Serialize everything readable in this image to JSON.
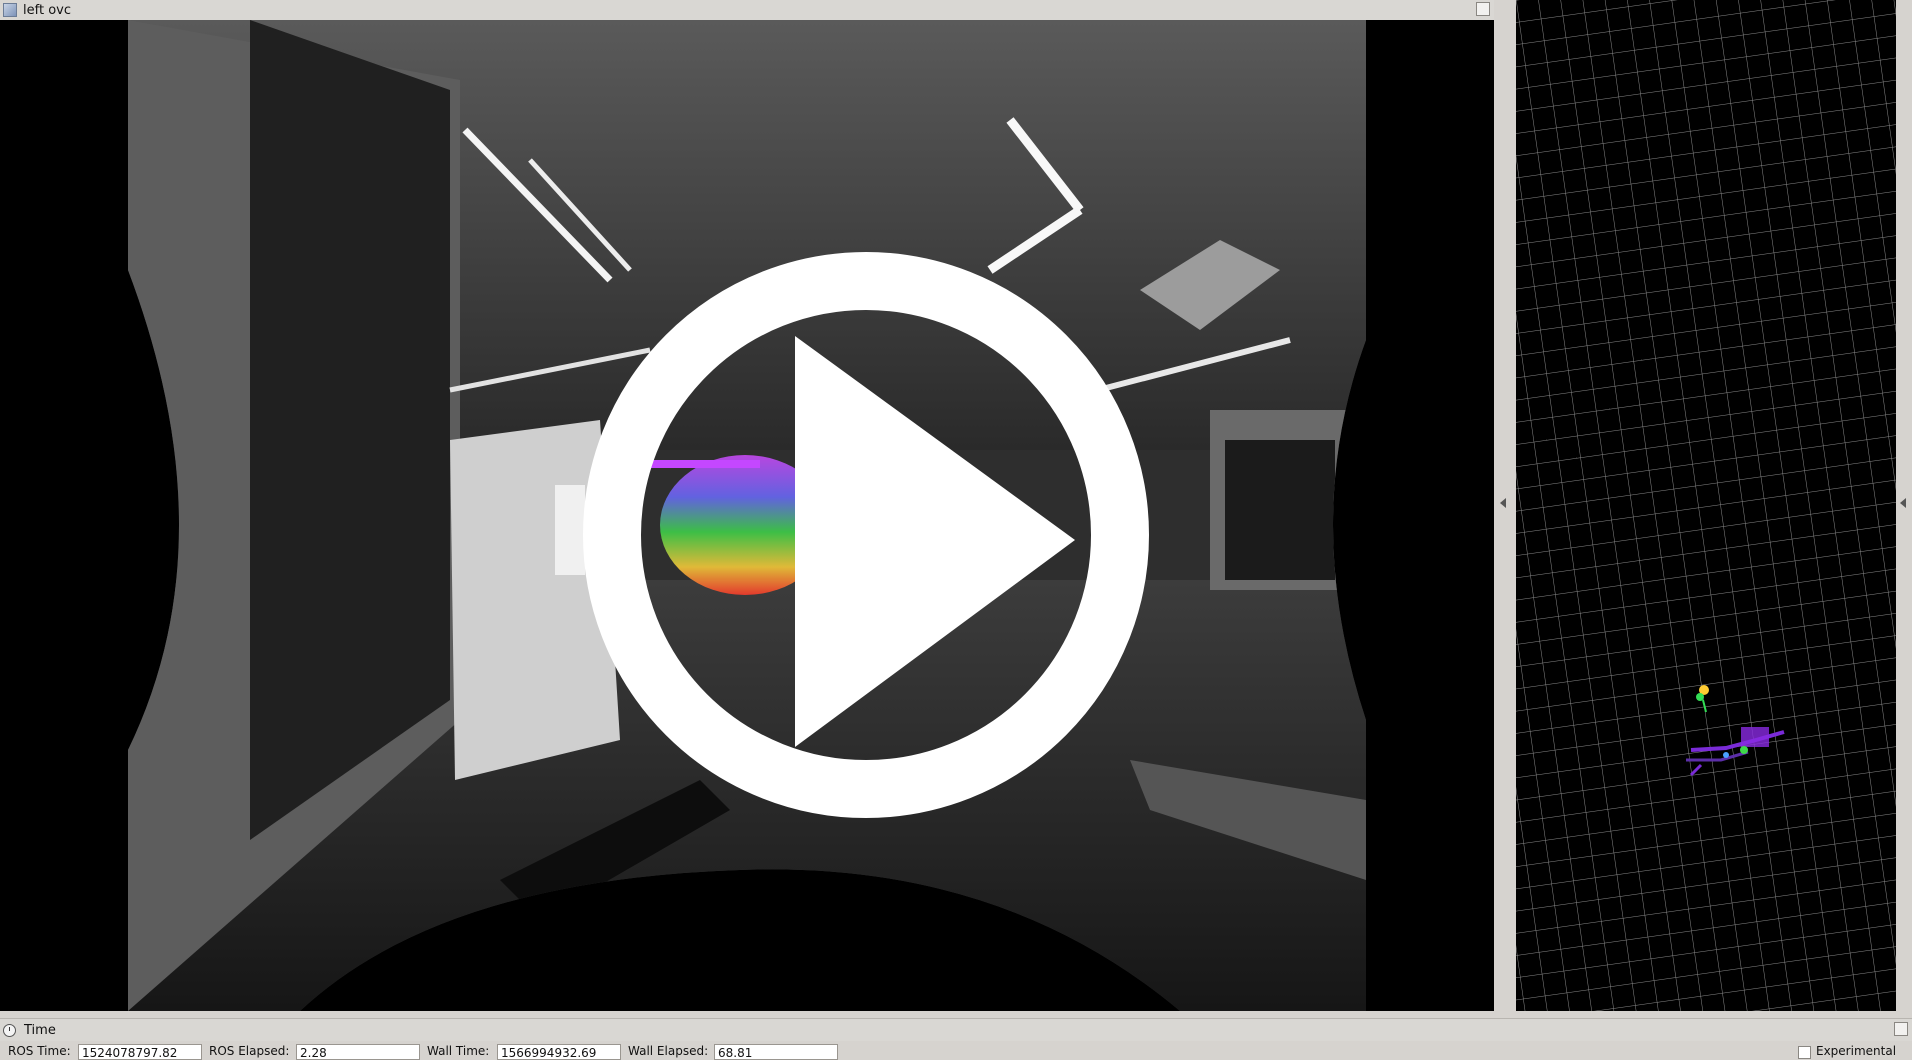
{
  "camera_panel": {
    "title": "left ovc",
    "icon": "image-view-icon",
    "overlay": "play-button-icon"
  },
  "map_panel": {
    "icon": "grid-view-icon"
  },
  "time_panel": {
    "title": "Time",
    "ros_time_label": "ROS Time:",
    "ros_time_value": "1524078797.82",
    "ros_elapsed_label": "ROS Elapsed:",
    "ros_elapsed_value": "2.28",
    "wall_time_label": "Wall Time:",
    "wall_time_value": "1566994932.69",
    "wall_elapsed_label": "Wall Elapsed:",
    "wall_elapsed_value": "68.81",
    "experimental_label": "Experimental"
  }
}
